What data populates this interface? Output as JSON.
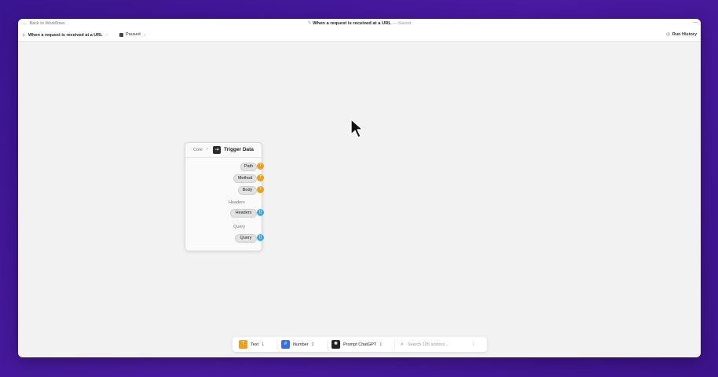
{
  "titlebar": {
    "back_label": "Back to Workflows",
    "title": "When a request is received at a URL",
    "saved": "— Saved",
    "window_control": "—"
  },
  "toolbar": {
    "workflow_name": "When a request is received at a URL",
    "status": "Paused",
    "run_history": "Run History"
  },
  "node": {
    "breadcrumb": "Core",
    "title": "Trigger Data",
    "outputs": [
      {
        "label": "Path",
        "port": "orange"
      },
      {
        "label": "Method",
        "port": "orange"
      },
      {
        "label": "Body",
        "port": "orange"
      }
    ],
    "sections": [
      {
        "label": "Headers",
        "pill": "Headers",
        "port": "blue"
      },
      {
        "label": "Query",
        "pill": "Query",
        "port": "blue"
      }
    ]
  },
  "bottombar": {
    "items": [
      {
        "label": "Text",
        "count": "1",
        "color": "#e8a122"
      },
      {
        "label": "Number",
        "count": "2",
        "color": "#3b6fe0"
      },
      {
        "label": "Prompt ChatGPT",
        "count": "1",
        "color": "#222222"
      }
    ],
    "search_placeholder": "Search 195 actions...",
    "shortcut": "/"
  }
}
